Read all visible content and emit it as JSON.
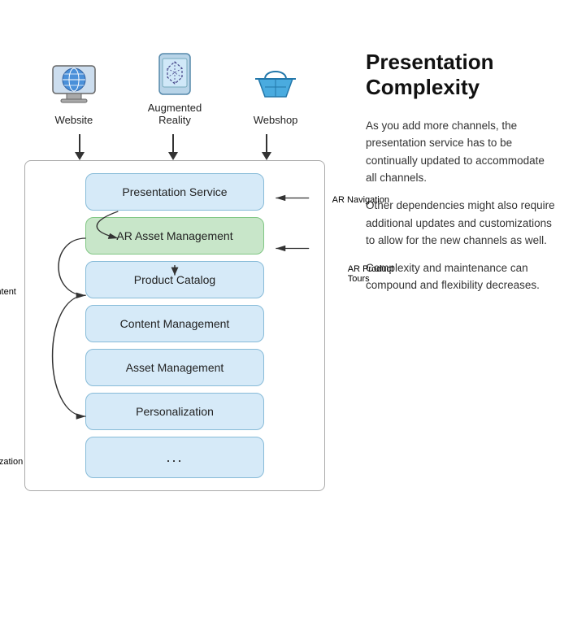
{
  "left": {
    "icons": [
      {
        "id": "website",
        "label": "Website"
      },
      {
        "id": "ar",
        "label": "Augmented\nReality"
      },
      {
        "id": "webshop",
        "label": "Webshop"
      }
    ],
    "services": [
      {
        "id": "presentation",
        "label": "Presentation Service",
        "style": "blue"
      },
      {
        "id": "ar-asset",
        "label": "AR Asset Management",
        "style": "green"
      },
      {
        "id": "product",
        "label": "Product Catalog",
        "style": "blue"
      },
      {
        "id": "content",
        "label": "Content Management",
        "style": "blue"
      },
      {
        "id": "asset",
        "label": "Asset Management",
        "style": "blue"
      },
      {
        "id": "personalization",
        "label": "Personalization",
        "style": "blue"
      },
      {
        "id": "more",
        "label": "...",
        "style": "empty"
      }
    ],
    "arrow_labels": {
      "ar_navigation": "AR Navigation",
      "ar_product_tours": "AR Product\nTours",
      "ar_content": "AR Content",
      "ar_personalization": "AR\nPersonalization"
    }
  },
  "right": {
    "title": "Presentation\nComplexity",
    "paragraphs": [
      "As you add more channels, the presentation service has to be continually updated to accommodate all channels.",
      "Other dependencies might also require additional updates and customizations to allow for the new channels as well.",
      "Complexity and maintenance can compound and flexibility decreases."
    ]
  }
}
